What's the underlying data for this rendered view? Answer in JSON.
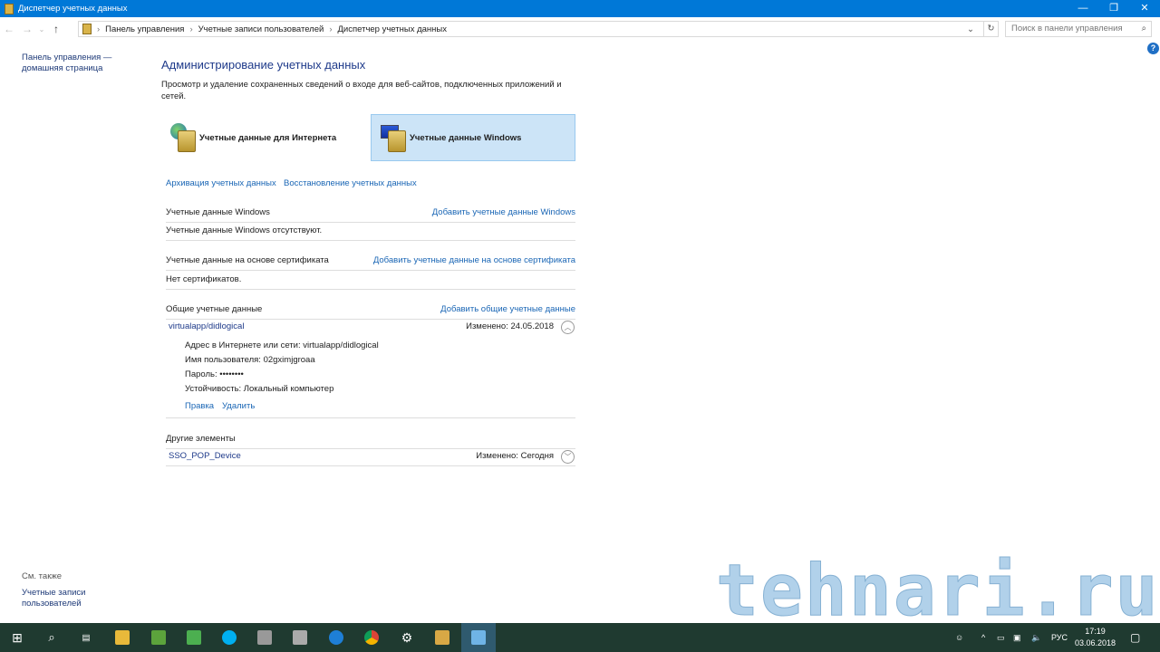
{
  "window": {
    "title": "Диспетчер учетных данных",
    "minimize": "—",
    "restore": "❐",
    "close": "✕"
  },
  "address": {
    "crumbs": [
      "Панель управления",
      "Учетные записи пользователей",
      "Диспетчер учетных данных"
    ],
    "search_placeholder": "Поиск в панели управления"
  },
  "sidebar": {
    "home": "Панель управления — домашняя страница",
    "see_also": "См. также",
    "user_accounts": "Учетные записи пользователей"
  },
  "main": {
    "title": "Администрирование учетных данных",
    "description": "Просмотр и удаление сохраненных сведений о входе для веб-сайтов, подключенных приложений и сетей.",
    "tiles": [
      {
        "label": "Учетные данные для Интернета",
        "selected": false
      },
      {
        "label": "Учетные данные Windows",
        "selected": true
      }
    ],
    "backup": "Архивация учетных данных",
    "restore": "Восстановление учетных данных",
    "windows_creds": {
      "title": "Учетные данные Windows",
      "add": "Добавить учетные данные Windows",
      "empty": "Учетные данные Windows отсутствуют."
    },
    "cert_creds": {
      "title": "Учетные данные на основе сертификата",
      "add": "Добавить учетные данные на основе сертификата",
      "empty": "Нет сертификатов."
    },
    "generic_creds": {
      "title": "Общие учетные данные",
      "add": "Добавить общие учетные данные",
      "item": {
        "name": "virtualapp/didlogical",
        "modified": "Изменено:  24.05.2018",
        "address": "Адрес в Интернете или сети:  virtualapp/didlogical",
        "username": "Имя пользователя:  02gximjgroaa",
        "password": "Пароль:  ••••••••",
        "persistence": "Устойчивость:  Локальный компьютер",
        "edit": "Правка",
        "delete": "Удалить"
      }
    },
    "other": {
      "title": "Другие элементы",
      "item": {
        "name": "SSO_POP_Device",
        "modified": "Изменено:  Сегодня"
      }
    }
  },
  "watermark": "tehnari.ru",
  "taskbar": {
    "lang": "РУС",
    "time": "17:19",
    "date": "03.06.2018"
  }
}
